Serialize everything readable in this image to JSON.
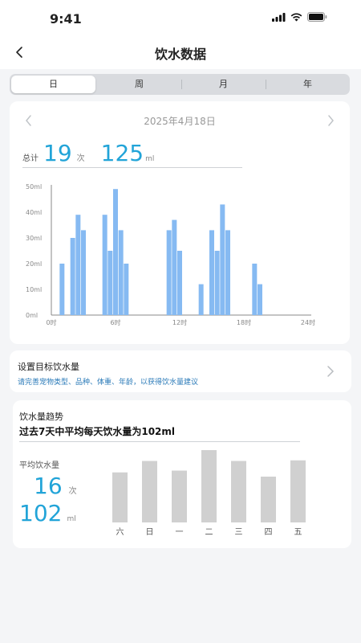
{
  "status_bar": {
    "time": "9:41"
  },
  "nav": {
    "title": "饮水数据"
  },
  "tabs": [
    {
      "label": "日",
      "active": true
    },
    {
      "label": "周"
    },
    {
      "label": "月"
    },
    {
      "label": "年"
    }
  ],
  "daily": {
    "date": "2025年4月18日",
    "total_label": "总计",
    "count": "19",
    "count_unit": "次",
    "volume": "125",
    "volume_unit": "ml"
  },
  "chart_data": [
    {
      "type": "bar",
      "xlabel": "",
      "ylabel": "",
      "ylim": [
        0,
        50
      ],
      "y_ticks": [
        "0ml",
        "10ml",
        "20ml",
        "30ml",
        "40ml",
        "50ml"
      ],
      "x_tick_labels": [
        "0时",
        "6时",
        "12时",
        "18时",
        "24时"
      ],
      "x_range": [
        0,
        24
      ],
      "x": [
        1,
        2,
        2.5,
        3,
        5,
        5.5,
        6,
        6.5,
        7,
        11,
        11.5,
        12,
        14,
        15,
        15.5,
        16,
        16.5,
        19,
        19.5
      ],
      "values": [
        20,
        30,
        39,
        33,
        39,
        25,
        49,
        33,
        20,
        33,
        37,
        25,
        12,
        33,
        25,
        43,
        33,
        20,
        12
      ]
    },
    {
      "type": "bar",
      "categories": [
        "六",
        "日",
        "一",
        "二",
        "三",
        "四",
        "五"
      ],
      "values": [
        83,
        102,
        86,
        120,
        102,
        76,
        103
      ],
      "ylim": [
        0,
        120
      ]
    }
  ],
  "goal": {
    "title": "设置目标饮水量",
    "subtitle": "请完善宠物类型、品种、体重、年龄，以获得饮水量建议"
  },
  "trend": {
    "title": "饮水量趋势",
    "summary": "过去7天中平均每天饮水量为102ml",
    "avg_label": "平均饮水量",
    "avg_count": "16",
    "avg_count_unit": "次",
    "avg_volume": "102",
    "avg_volume_unit": "ml"
  },
  "colors": {
    "accent": "#22a4d8",
    "bar_daily": "#86baf2",
    "bar_weekly": "#d0d0d0"
  },
  "icons": {
    "back": "chevron-left-icon",
    "prev": "chevron-left-icon",
    "next": "chevron-right-icon",
    "goal_arrow": "chevron-right-icon"
  }
}
